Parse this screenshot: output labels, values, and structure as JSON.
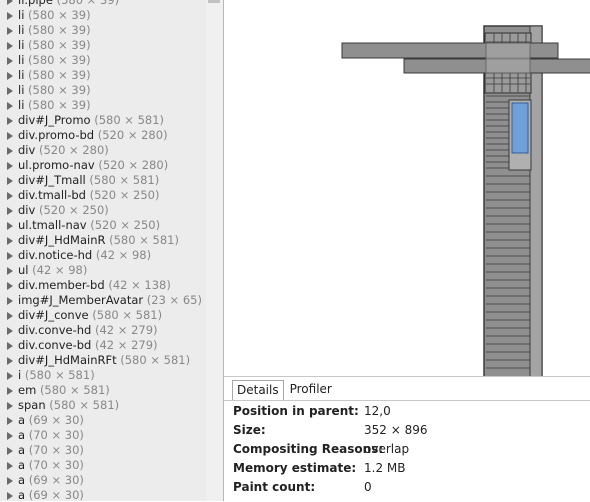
{
  "layer_tree": [
    {
      "name": "li.pipe",
      "dims": "(580 × 39)"
    },
    {
      "name": "li",
      "dims": "(580 × 39)"
    },
    {
      "name": "li",
      "dims": "(580 × 39)"
    },
    {
      "name": "li",
      "dims": "(580 × 39)"
    },
    {
      "name": "li",
      "dims": "(580 × 39)"
    },
    {
      "name": "li",
      "dims": "(580 × 39)"
    },
    {
      "name": "li",
      "dims": "(580 × 39)"
    },
    {
      "name": "li",
      "dims": "(580 × 39)"
    },
    {
      "name": "div#J_Promo",
      "dims": "(580 × 581)"
    },
    {
      "name": "div.promo-bd",
      "dims": "(520 × 280)"
    },
    {
      "name": "div",
      "dims": "(520 × 280)"
    },
    {
      "name": "ul.promo-nav",
      "dims": "(520 × 280)"
    },
    {
      "name": "div#J_Tmall",
      "dims": "(580 × 581)"
    },
    {
      "name": "div.tmall-bd",
      "dims": "(520 × 250)"
    },
    {
      "name": "div",
      "dims": "(520 × 250)"
    },
    {
      "name": "ul.tmall-nav",
      "dims": "(520 × 250)"
    },
    {
      "name": "div#J_HdMainR",
      "dims": "(580 × 581)"
    },
    {
      "name": "div.notice-hd",
      "dims": "(42 × 98)"
    },
    {
      "name": "ul",
      "dims": "(42 × 98)"
    },
    {
      "name": "div.member-bd",
      "dims": "(42 × 138)"
    },
    {
      "name": "img#J_MemberAvatar",
      "dims": "(23 × 65)"
    },
    {
      "name": "div#J_conve",
      "dims": "(580 × 581)"
    },
    {
      "name": "div.conve-hd",
      "dims": "(42 × 279)"
    },
    {
      "name": "div.conve-bd",
      "dims": "(42 × 279)"
    },
    {
      "name": "div#J_HdMainRFt",
      "dims": "(580 × 581)"
    },
    {
      "name": "i",
      "dims": "(580 × 581)"
    },
    {
      "name": "em",
      "dims": "(580 × 581)"
    },
    {
      "name": "span",
      "dims": "(580 × 581)"
    },
    {
      "name": "a",
      "dims": "(69 × 30)"
    },
    {
      "name": "a",
      "dims": "(70 × 30)"
    },
    {
      "name": "a",
      "dims": "(70 × 30)"
    },
    {
      "name": "a",
      "dims": "(70 × 30)"
    },
    {
      "name": "a",
      "dims": "(69 × 30)"
    },
    {
      "name": "a",
      "dims": "(69 × 30)"
    }
  ],
  "panel": {
    "tabs": [
      {
        "label": "Details",
        "active": true
      },
      {
        "label": "Profiler",
        "active": false
      }
    ],
    "details": [
      {
        "label": "Position in parent:",
        "value": "12,0"
      },
      {
        "label": "Size:",
        "value": "352 × 896"
      },
      {
        "label": "Compositing Reasons:",
        "value": "overlap"
      },
      {
        "label": "Memory estimate:",
        "value": "1.2 MB"
      },
      {
        "label": "Paint count:",
        "value": "0"
      }
    ]
  },
  "colors": {
    "layer_fill": "#8f8f8f",
    "layer_border": "#3a3a3a",
    "selected_layer": "#6fa0d8",
    "tree_background": "#ececec"
  }
}
